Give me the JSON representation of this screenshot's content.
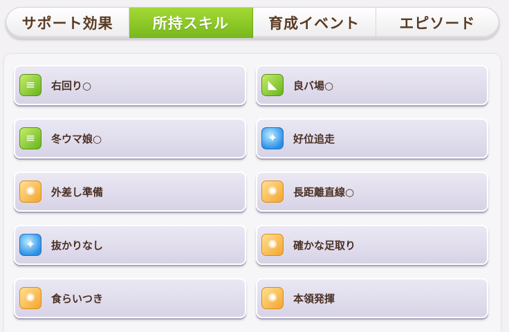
{
  "tabs": [
    {
      "label": "サポート効果",
      "active": false
    },
    {
      "label": "所持スキル",
      "active": true
    },
    {
      "label": "育成イベント",
      "active": false
    },
    {
      "label": "エピソード",
      "active": false
    }
  ],
  "skills": [
    {
      "name": "右回り○",
      "icon": "green-speed-icon",
      "color": "#8fd23a"
    },
    {
      "name": "良バ場○",
      "icon": "green-ground-icon",
      "color": "#8fd23a"
    },
    {
      "name": "冬ウマ娘○",
      "icon": "green-speed-icon",
      "color": "#8fd23a"
    },
    {
      "name": "好位追走",
      "icon": "blue-sparkle-icon",
      "color": "#3a9bea"
    },
    {
      "name": "外差し準備",
      "icon": "orange-runner-icon",
      "color": "#f5b340"
    },
    {
      "name": "長距離直線○",
      "icon": "orange-runner-icon",
      "color": "#f5b340"
    },
    {
      "name": "抜かりなし",
      "icon": "blue-sparkle-icon",
      "color": "#3a9bea"
    },
    {
      "name": "確かな足取り",
      "icon": "orange-runner-icon",
      "color": "#f5b340"
    },
    {
      "name": "食らいつき",
      "icon": "orange-runner-icon",
      "color": "#f5b340"
    },
    {
      "name": "本領発揮",
      "icon": "orange-runner-icon",
      "color": "#f5b340"
    }
  ]
}
